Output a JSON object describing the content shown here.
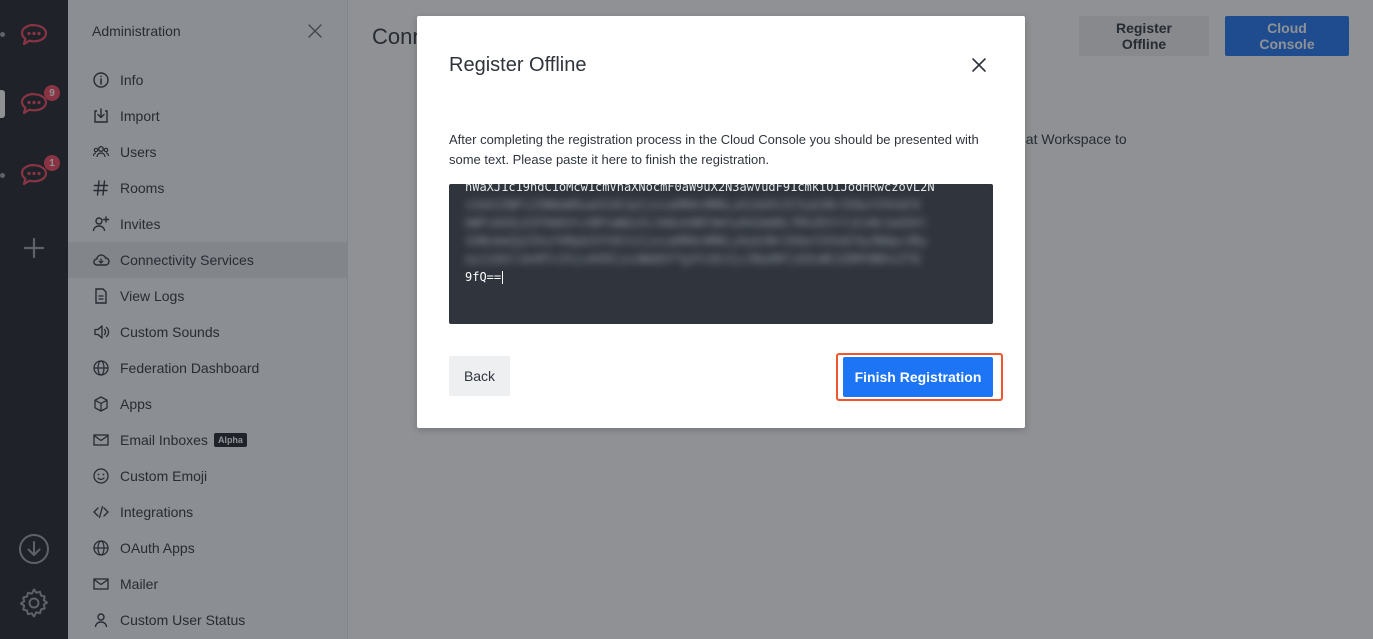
{
  "rail": {
    "servers": [
      {
        "name": "server-1",
        "badge": ""
      },
      {
        "name": "server-2",
        "badge": "9"
      },
      {
        "name": "server-3",
        "badge": "1"
      }
    ],
    "brand_color": "#f5455c"
  },
  "sidebar": {
    "title": "Administration",
    "items": [
      {
        "label": "Info",
        "icon": "info-icon"
      },
      {
        "label": "Import",
        "icon": "import-icon"
      },
      {
        "label": "Users",
        "icon": "users-icon"
      },
      {
        "label": "Rooms",
        "icon": "hashtag-icon"
      },
      {
        "label": "Invites",
        "icon": "user-plus-icon"
      },
      {
        "label": "Connectivity Services",
        "icon": "cloud-icon",
        "active": true
      },
      {
        "label": "View Logs",
        "icon": "document-icon"
      },
      {
        "label": "Custom Sounds",
        "icon": "speaker-icon"
      },
      {
        "label": "Federation Dashboard",
        "icon": "globe-icon"
      },
      {
        "label": "Apps",
        "icon": "cube-icon"
      },
      {
        "label": "Email Inboxes",
        "icon": "mail-icon",
        "tag": "Alpha"
      },
      {
        "label": "Custom Emoji",
        "icon": "emoji-icon"
      },
      {
        "label": "Integrations",
        "icon": "code-icon"
      },
      {
        "label": "OAuth Apps",
        "icon": "globe-icon"
      },
      {
        "label": "Mailer",
        "icon": "mail-icon"
      },
      {
        "label": "Custom User Status",
        "icon": "user-icon"
      }
    ]
  },
  "main": {
    "title": "Conn",
    "register_offline_label": "Register Offline",
    "cloud_console_label": "Cloud Console",
    "partial_text": ".Chat Workspace to"
  },
  "modal": {
    "title": "Register Offline",
    "description": "After completing the registration process in the Cloud Console you should be presented with some text. Please paste it here to finish the registration.",
    "token_lines": [
      "hWaXJ1c19ndC1oMcw1cmVhaXNocmF0aW9uX2N3awVudF91cmkiOiJodHRwczovL2N",
      "sIm52ZWFiZ3N0aW9uaUIdXJpIjoiaHR0cHM6Ly9jbG91ZC5yb2NrZXQuY2hhdC9",
      "bWFsbG9jX2F0dGVtcHRfaWQiOiJkNzk0NTdmYy04ZmQ0LTRhZDItYjEzNi1mZGVl",
      "IGNvbmZpZ3VyYXRpb25fdXJsIjoiaHR0cHM6Ly9yb2NrZXQuY2hhdC9yZWdpc3Ry",
      "eyJjbGllbnRfc2VjcmV0IjoiNmQ5YTg3YzQtZjc2Ny00YjQ3LWE2ZDMtNDk1ZTQ"
    ],
    "token_end": "9fQ==",
    "back_label": "Back",
    "finish_label": "Finish Registration"
  }
}
